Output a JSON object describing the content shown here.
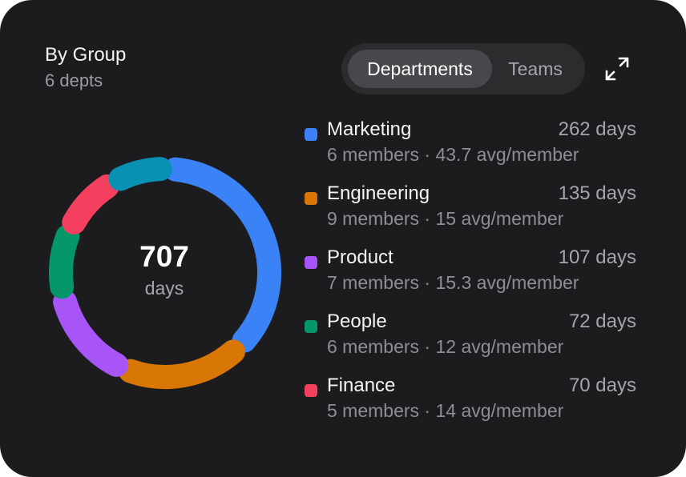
{
  "header": {
    "title": "By Group",
    "subtitle": "6 depts"
  },
  "toggle": {
    "options": [
      "Departments",
      "Teams"
    ],
    "selected": "Departments"
  },
  "expand_icon": "expand-icon",
  "total": {
    "value": "707",
    "unit": "days"
  },
  "groups": [
    {
      "name": "Marketing",
      "value_label": "262 days",
      "meta": "6 members · 43.7 avg/member",
      "value": 262,
      "color": "#3b82f6"
    },
    {
      "name": "Engineering",
      "value_label": "135 days",
      "meta": "9 members · 15 avg/member",
      "value": 135,
      "color": "#d97706"
    },
    {
      "name": "Product",
      "value_label": "107 days",
      "meta": "7 members · 15.3 avg/member",
      "value": 107,
      "color": "#a855f7"
    },
    {
      "name": "People",
      "value_label": "72 days",
      "meta": "6 members · 12 avg/member",
      "value": 72,
      "color": "#059669"
    },
    {
      "name": "Finance",
      "value_label": "70 days",
      "meta": "5 members · 14 avg/member",
      "value": 70,
      "color": "#f43f5e"
    }
  ],
  "chart_data": {
    "type": "pie",
    "style": "donut",
    "categories": [
      "Marketing",
      "Engineering",
      "Product",
      "People",
      "Finance",
      ""
    ],
    "values": [
      262,
      135,
      107,
      72,
      70,
      61
    ],
    "colors": [
      "#3b82f6",
      "#d97706",
      "#a855f7",
      "#059669",
      "#f43f5e",
      "#0891b2"
    ],
    "center_value": "707",
    "center_label": "days"
  }
}
